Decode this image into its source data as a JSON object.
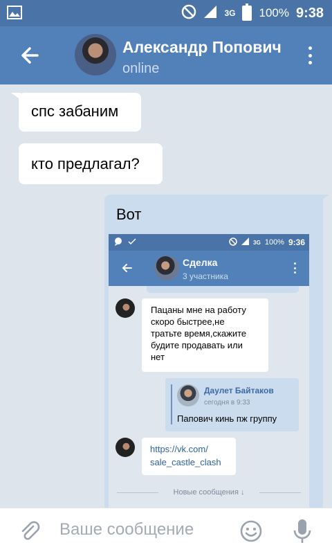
{
  "status_bar": {
    "battery": "100%",
    "network": "3G",
    "time": "9:38"
  },
  "header": {
    "name": "Александр Попович",
    "status": "online"
  },
  "messages": {
    "in1": "спс забаним",
    "in2": "кто предлагал?",
    "out_text": "Вот"
  },
  "embedded": {
    "status": {
      "battery": "100%",
      "network": "3G",
      "time": "9:36"
    },
    "title": "Сделка",
    "subtitle": "3 участника",
    "msg1_lines": [
      "Пацаны мне на работу",
      "скоро быстрее,не",
      "тратьте время,скажите",
      "будите продавать или",
      "нет"
    ],
    "quote": {
      "author": "Даулет Байтаков",
      "date": "сегодня в 9:33",
      "text": "Папович кинь пж группу"
    },
    "link_lines": [
      "https://vk.com/",
      "sale_castle_clash"
    ],
    "new_messages": "Новые сообщения ↓"
  },
  "composer": {
    "placeholder": "Ваше сообщение"
  }
}
